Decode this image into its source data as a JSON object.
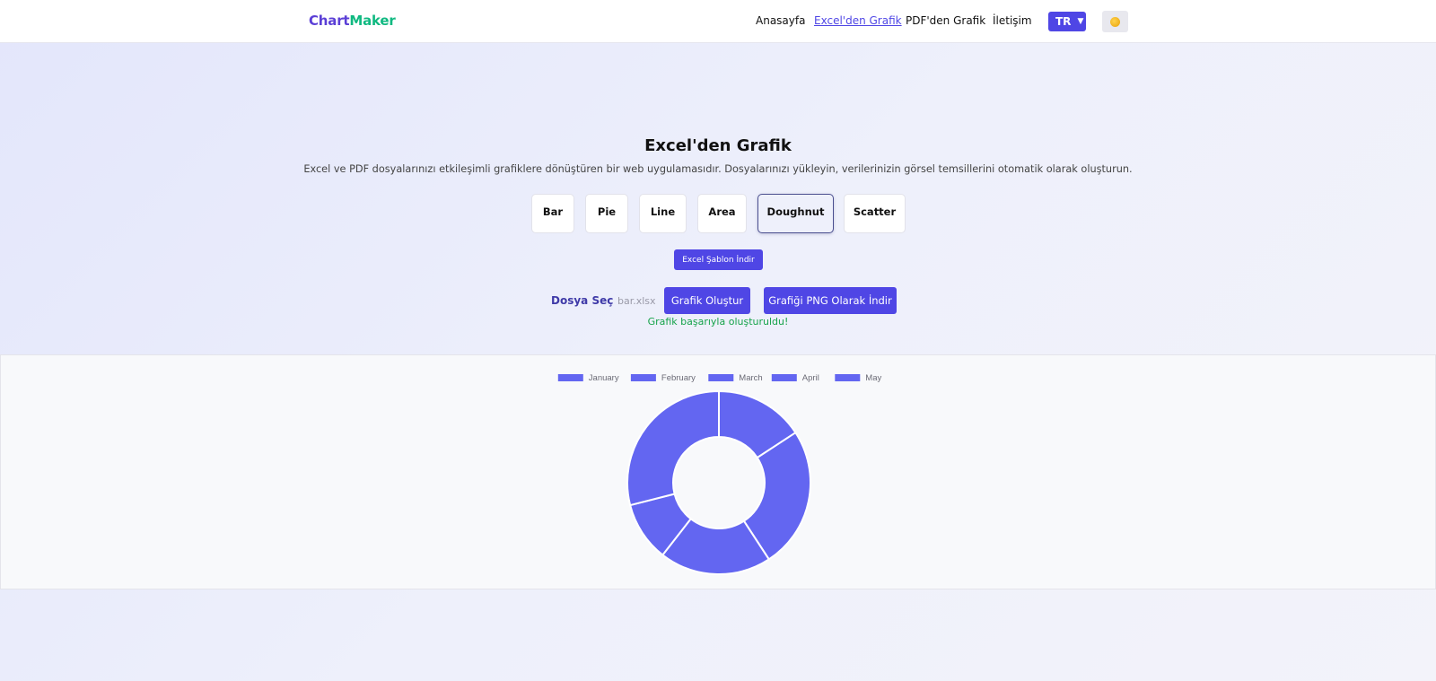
{
  "header": {
    "brand_part1": "Chart",
    "brand_part2": "Maker",
    "nav": [
      "Anasayfa",
      "Excel'den Grafik",
      "PDF'den Grafik",
      "İletişim"
    ],
    "active_nav": "Excel'den Grafik",
    "language": "TR",
    "theme_icon": "sun-icon"
  },
  "hero": {
    "title": "Excel'den Grafik",
    "subtitle": "Excel ve PDF dosyalarınızı etkileşimli grafiklere dönüştüren bir web uygulamasıdır. Dosyalarınızı yükleyin, verilerinizin görsel temsillerini otomatik olarak oluşturun."
  },
  "chart_types": [
    "Bar",
    "Pie",
    "Line",
    "Area",
    "Doughnut",
    "Scatter"
  ],
  "selected_chart_type": "Doughnut",
  "template_button": "Excel Şablon İndir",
  "file": {
    "choose_label": "Dosya Seç",
    "file_name": "bar.xlsx",
    "create_button": "Grafik Oluştur",
    "download_button": "Grafiği PNG Olarak İndir",
    "success_message": "Grafik başarıyla oluşturuldu!"
  },
  "chart_data": {
    "type": "doughnut",
    "categories": [
      "January",
      "February",
      "March",
      "April",
      "May"
    ],
    "values": [
      12,
      19,
      15,
      8,
      22
    ],
    "color": "#6366f1",
    "legend_position": "top"
  }
}
